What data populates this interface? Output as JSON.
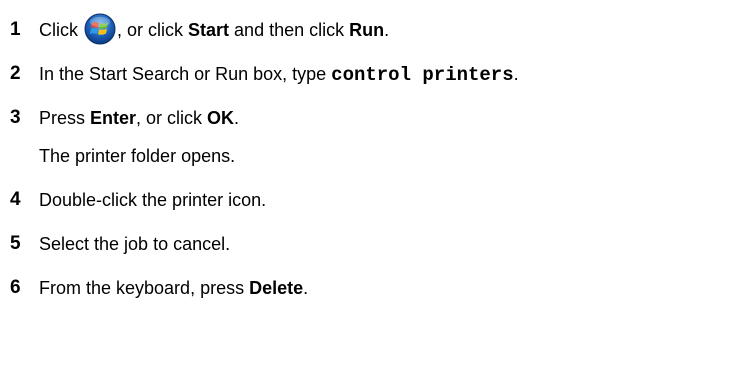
{
  "steps": [
    {
      "number": "1",
      "pre": "Click",
      "icon": "windows-start-orb-icon",
      "mid": ", or click ",
      "bold1": "Start",
      "mid2": " and then click ",
      "bold2": "Run",
      "post": "."
    },
    {
      "number": "2",
      "pre": "In the Start Search or Run box, type ",
      "code": "control printers",
      "post": "."
    },
    {
      "number": "3",
      "pre": "Press ",
      "bold1": "Enter",
      "mid": ", or click ",
      "bold2": "OK",
      "post": ".",
      "sub": "The printer folder opens."
    },
    {
      "number": "4",
      "text": "Double-click the printer icon."
    },
    {
      "number": "5",
      "text": "Select the job to cancel."
    },
    {
      "number": "6",
      "pre": "From the keyboard, press ",
      "bold": "Delete",
      "post": "."
    }
  ],
  "colors": {
    "orb_blue": "#1c5fb8",
    "flag_red": "#e8472b",
    "flag_green": "#6cbf2f",
    "flag_blue": "#2d9be8",
    "flag_yellow": "#f4c21b"
  }
}
